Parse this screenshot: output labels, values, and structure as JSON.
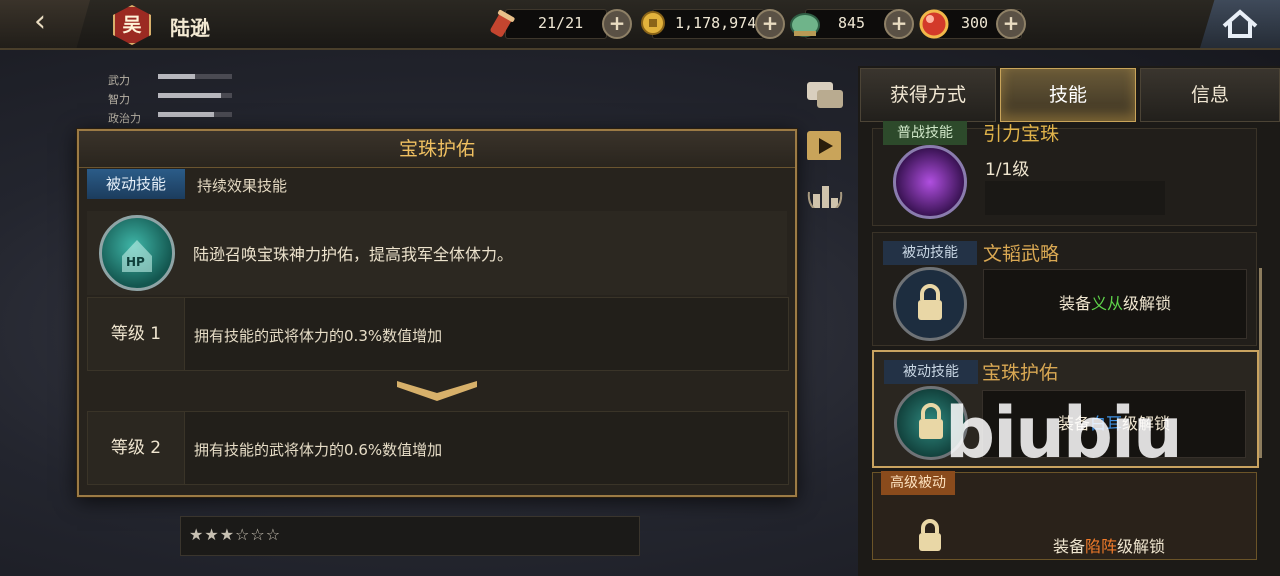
{
  "header": {
    "back_icon": "‹",
    "faction": "吴",
    "hero_name": "陆逊",
    "resources": [
      {
        "name": "stamina",
        "value": "21/21"
      },
      {
        "name": "coins",
        "value": "1,178,974"
      },
      {
        "name": "jade",
        "value": "845"
      },
      {
        "name": "gems",
        "value": "300"
      }
    ],
    "plus": "+"
  },
  "stats": [
    {
      "label": "武力",
      "level": 0.5
    },
    {
      "label": "智力",
      "level": 0.85
    },
    {
      "label": "政治力",
      "level": 0.75
    }
  ],
  "popup": {
    "title": "宝珠护佑",
    "type_tag": "被动技能",
    "subtype": "持续效果技能",
    "icon_text": "HP",
    "description": "陆逊召唤宝珠神力护佑，提高我军全体体力。",
    "levels": [
      {
        "label": "等级 1",
        "text": "拥有技能的武将体力的0.3%数值增加"
      },
      {
        "label": "等级 2",
        "text": "拥有技能的武将体力的0.6%数值增加"
      }
    ]
  },
  "tabs": [
    "获得方式",
    "技能",
    "信息"
  ],
  "skills": [
    {
      "tag": "普战技能",
      "name": "引力宝珠",
      "level": "1/1级"
    },
    {
      "tag": "被动技能",
      "name": "文韬武略",
      "unlock_prefix": "装备",
      "unlock_rank": "义从",
      "unlock_suffix": "级解锁"
    },
    {
      "tag": "被动技能",
      "name": "宝珠护佑",
      "unlock_prefix": "装备",
      "unlock_rank": "白耳",
      "unlock_suffix": "级解锁"
    },
    {
      "tag": "高级被动",
      "unlock_prefix": "装备",
      "unlock_rank": "陷阵",
      "unlock_suffix": "级解锁"
    }
  ],
  "colors": {
    "gold": "#f0c061",
    "green_rank": "#5ed34a",
    "blue_rank": "#3d8fe0",
    "orange_rank": "#f07a2a"
  },
  "watermark": "biubiu",
  "stars": "★★★☆☆☆"
}
